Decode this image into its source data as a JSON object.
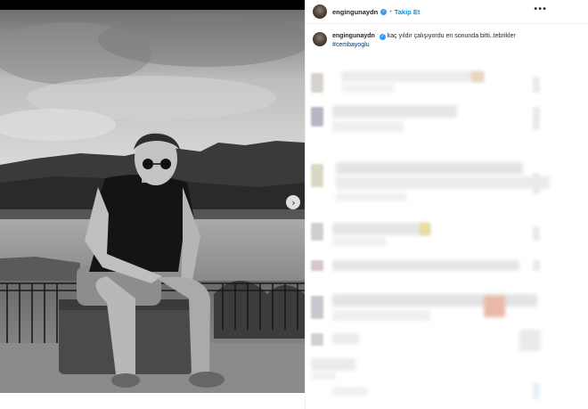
{
  "post": {
    "username": "engingunaydn",
    "follow_label": "Takip Et",
    "more_label": "•••",
    "caption_text": "kaç yıldır çalışıyordu en sonunda bitti..tebrikler",
    "hashtag": "#cembayoglu"
  },
  "icons": {
    "verified": "verified-badge-icon",
    "next": "chevron-right-icon",
    "more": "more-options-icon"
  },
  "colors": {
    "link_blue": "#0095f6",
    "verified_blue": "#3897f0"
  }
}
